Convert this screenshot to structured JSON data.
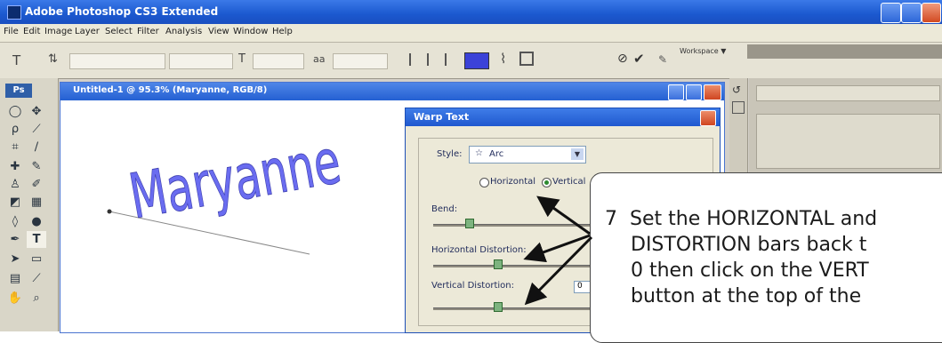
{
  "window": {
    "title": "Adobe Photoshop CS3 Extended"
  },
  "menubar": {
    "items": [
      "File",
      "Edit",
      "Image",
      "Layer",
      "Select",
      "Filter",
      "Analysis",
      "View",
      "Window",
      "Help"
    ]
  },
  "optionsbar": {
    "workspace_label": "Workspace ▼"
  },
  "tools": {
    "logo": "Ps"
  },
  "document": {
    "title": "Untitled-1 @ 95.3% (Maryanne, RGB/8)",
    "artwork_text": "Maryanne"
  },
  "warp_dialog": {
    "title": "Warp Text",
    "style_label": "Style:",
    "style_value": "Arc",
    "horizontal_label": "Horizontal",
    "vertical_label": "Vertical",
    "bend_label": "Bend:",
    "horizontal_distortion_label": "Horizontal Distortion:",
    "vertical_distortion_label": "Vertical Distortion:",
    "vertical_distortion_value": "0"
  },
  "callout": {
    "step_number": "7",
    "lines": [
      "Set the HORIZONTAL and",
      "DISTORTION bars back t",
      "0 then click on the VERT",
      "button at the top of the"
    ]
  },
  "colors": {
    "titlebar": "#1b58cf",
    "warp_text": "#6a6cf0"
  }
}
